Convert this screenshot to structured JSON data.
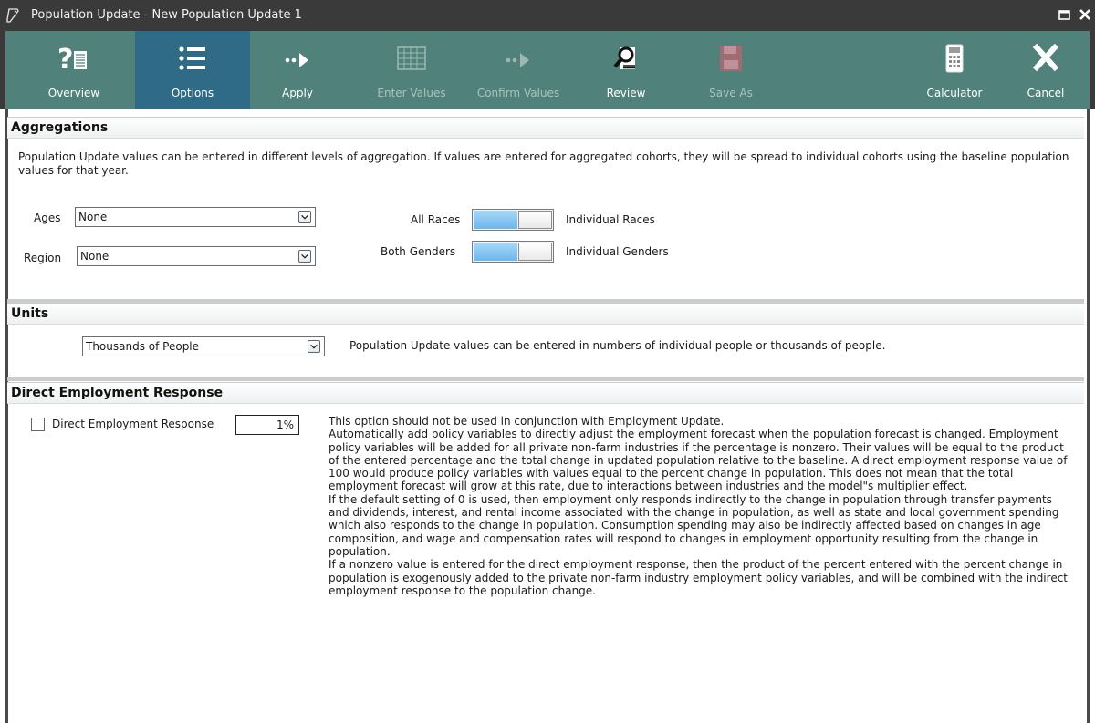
{
  "window": {
    "title": "Population Update - New Population Update 1",
    "icons": {
      "app": "document-pen-icon",
      "maximize": "maximize-icon",
      "close": "close-icon"
    }
  },
  "toolbar": {
    "overview": {
      "label": "Overview",
      "icon": "question-document-icon"
    },
    "options": {
      "label": "Options",
      "icon": "list-icon",
      "active": true
    },
    "apply": {
      "label": "Apply",
      "icon": "dots-arrow-icon"
    },
    "enter_values": {
      "label": "Enter Values",
      "icon": "grid-icon",
      "disabled": true
    },
    "confirm_values": {
      "label": "Confirm Values",
      "icon": "dots-arrow-icon",
      "disabled": true
    },
    "review": {
      "label": "Review",
      "icon": "magnifier-document-icon"
    },
    "save_as": {
      "label": "Save As",
      "icon": "floppy-disk-icon",
      "disabled": true
    },
    "calculator": {
      "label": "Calculator",
      "icon": "calculator-icon"
    },
    "cancel": {
      "label": "Cancel",
      "icon": "x-icon"
    },
    "colors": {
      "background": "#50817a",
      "active": "#2f6b87"
    }
  },
  "aggregations": {
    "header": "Aggregations",
    "description": "Population Update values can be entered in different levels of aggregation.  If values are entered for aggregated cohorts, they will be spread to individual cohorts using the baseline population values for that year.",
    "ages_label": "Ages",
    "ages_value": "None",
    "region_label": "Region",
    "region_value": "None",
    "races_left": "All Races",
    "races_right": "Individual Races",
    "genders_left": "Both Genders",
    "genders_right": "Individual Genders"
  },
  "units": {
    "header": "Units",
    "value": "Thousands of People",
    "description": "Population Update values can be entered in numbers of individual people or thousands of people."
  },
  "direct_employment": {
    "header": "Direct Employment Response",
    "checkbox_label": "Direct Employment Response",
    "checked": false,
    "value": "1%",
    "paragraphs": [
      "This option should not be used in conjunction with Employment Update.",
      "Automatically add policy variables to directly adjust the employment forecast when the population forecast is changed. Employment policy variables will be added for all private non-farm industries if the percentage is nonzero. Their values will be equal to the product of the entered percentage and the total change in updated population relative to the baseline. A direct employment response value of 100 would produce policy variables with values equal to the percent change in population. This does not mean that the total employment forecast will grow at this rate, due to interactions between industries and the model\"s multiplier effect.",
      "If the default setting of 0 is used, then employment only responds indirectly to the change in population through transfer payments and dividends, interest, and rental income associated with the change in population, as well as state and local government spending which also responds to the change in population. Consumption spending may also be indirectly affected based on changes in age composition, and wage and compensation rates will respond to changes in employment opportunity resulting from the change in population.",
      "If a nonzero value is entered for the direct employment response, then the product of the percent entered with the percent change in population is exogenously added to the private non-farm industry employment policy variables, and will be combined with the indirect employment response to the population change."
    ]
  }
}
